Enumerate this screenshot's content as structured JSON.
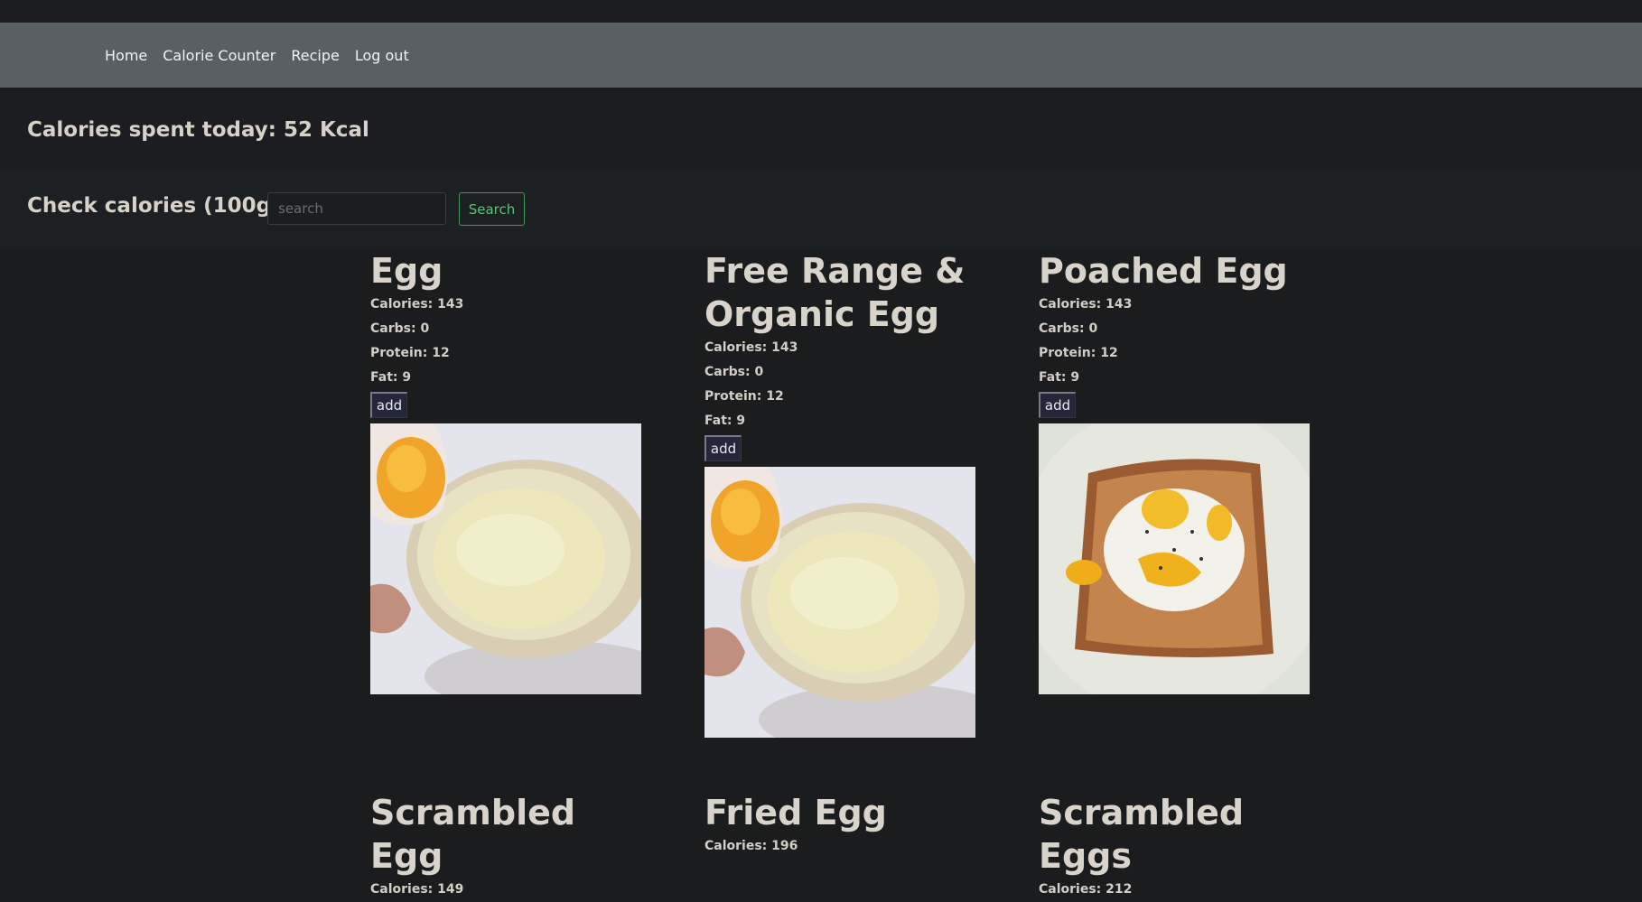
{
  "nav": {
    "items": [
      "Home",
      "Calorie Counter",
      "Recipe",
      "Log out"
    ]
  },
  "summary": {
    "calories_spent": "Calories spent today: 52 Kcal"
  },
  "search": {
    "label": "Check calories (100g):",
    "placeholder": "search",
    "button": "Search"
  },
  "foods": [
    {
      "name": "Egg",
      "calories": "Calories: 143",
      "carbs": "Carbs: 0",
      "protein": "Protein: 12",
      "fat": "Fat: 9",
      "add": "add",
      "image": "cracked-egg-bowl"
    },
    {
      "name": "Free Range & Organic Egg",
      "calories": "Calories: 143",
      "carbs": "Carbs: 0",
      "protein": "Protein: 12",
      "fat": "Fat: 9",
      "add": "add",
      "image": "cracked-egg-bowl"
    },
    {
      "name": "Poached Egg",
      "calories": "Calories: 143",
      "carbs": "Carbs: 0",
      "protein": "Protein: 12",
      "fat": "Fat: 9",
      "add": "add",
      "image": "poached-egg-toast"
    },
    {
      "name": "Scrambled Egg",
      "calories": "Calories: 149"
    },
    {
      "name": "Fried Egg",
      "calories": "Calories: 196"
    },
    {
      "name": "Scrambled Eggs",
      "calories": "Calories: 212"
    }
  ]
}
